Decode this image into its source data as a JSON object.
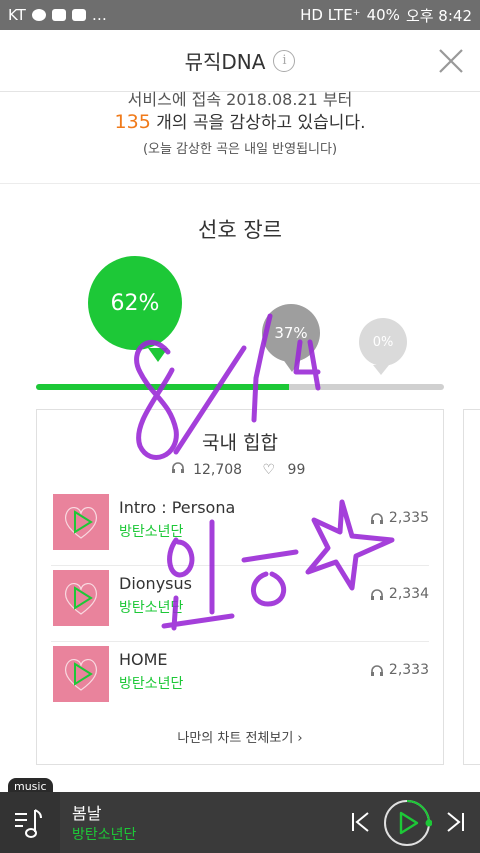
{
  "statusbar": {
    "carrier": "KT",
    "icon_talk": "talk",
    "right_text": "HD LTE⁺",
    "battery": "40%",
    "time": "오후 8:42"
  },
  "header": {
    "title": "뮤직DNA",
    "info": "i"
  },
  "intro": {
    "line1": "서비스에 접속 2018.08.21 부터",
    "count": "135",
    "line2_rest": "개의 곡을 감상하고 있습니다.",
    "line3": "(오늘 감상한 곡은 내일 반영됩니다)"
  },
  "section_title": "선호 장르",
  "genre_bubbles": [
    {
      "label": "62%",
      "value": 62,
      "color": "#1dc837"
    },
    {
      "label": "37%",
      "value": 37,
      "color": "#9e9e9e"
    },
    {
      "label": "0%",
      "value": 0,
      "color": "#dadada"
    }
  ],
  "card": {
    "genre": "국내 힙합",
    "listens": "12,708",
    "likes": "99",
    "songs": [
      {
        "name": "Intro : Persona",
        "artist": "방탄소년단",
        "plays": "2,335"
      },
      {
        "name": "Dionysus",
        "artist": "방탄소년단",
        "plays": "2,334"
      },
      {
        "name": "HOME",
        "artist": "방탄소년단",
        "plays": "2,333"
      }
    ],
    "more": "나만의 차트 전체보기 ›"
  },
  "scribble": {
    "line1": "8/14",
    "line2": "인증"
  },
  "player": {
    "tag": "music",
    "title": "봄날",
    "artist": "방탄소년단",
    "accent": "#1dc837"
  }
}
